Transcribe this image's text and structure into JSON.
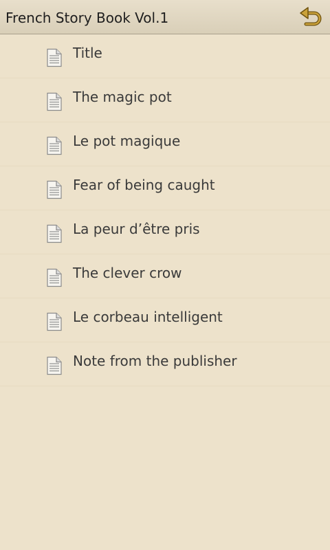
{
  "header": {
    "title": "French Story Book Vol.1",
    "back_icon": "undo-arrow-icon",
    "accent_color": "#7a5c12"
  },
  "toc": {
    "item_icon": "document-icon",
    "items": [
      {
        "label": "Title"
      },
      {
        "label": "The magic pot"
      },
      {
        "label": "Le pot magique"
      },
      {
        "label": "Fear of being caught"
      },
      {
        "label": "La peur d’être pris"
      },
      {
        "label": "The clever crow"
      },
      {
        "label": "Le corbeau intelligent"
      },
      {
        "label": "Note from the publisher"
      }
    ]
  },
  "colors": {
    "background": "#ede2cb",
    "title_bar": "#ddd3bd",
    "text": "#3a3a3a",
    "divider": "#e6dac1"
  }
}
